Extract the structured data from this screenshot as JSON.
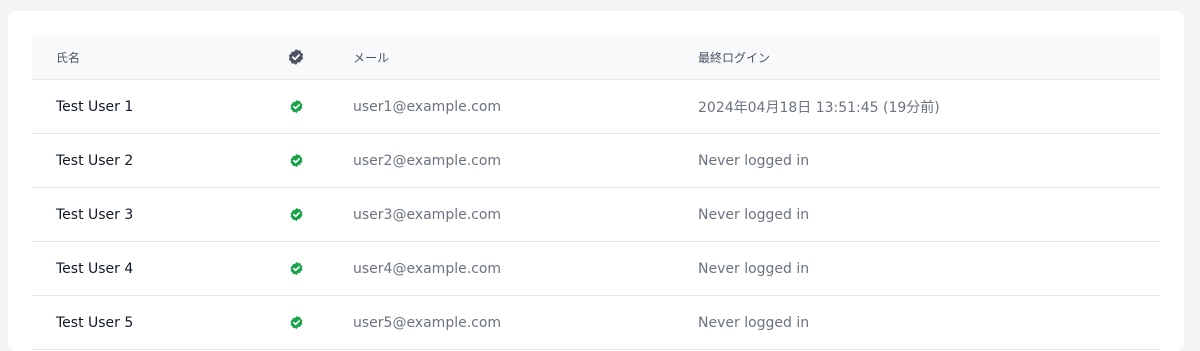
{
  "table": {
    "columns": {
      "name": "氏名",
      "verified_icon": "verified-badge-icon",
      "email": "メール",
      "last_login": "最終ログイン"
    },
    "rows": [
      {
        "name": "Test User 1",
        "verified": true,
        "email": "user1@example.com",
        "last_login": "2024年04月18日 13:51:45 (19分前)"
      },
      {
        "name": "Test User 2",
        "verified": true,
        "email": "user2@example.com",
        "last_login": "Never logged in"
      },
      {
        "name": "Test User 3",
        "verified": true,
        "email": "user3@example.com",
        "last_login": "Never logged in"
      },
      {
        "name": "Test User 4",
        "verified": true,
        "email": "user4@example.com",
        "last_login": "Never logged in"
      },
      {
        "name": "Test User 5",
        "verified": true,
        "email": "user5@example.com",
        "last_login": "Never logged in"
      }
    ]
  },
  "colors": {
    "verified_green": "#16a34a",
    "header_icon": "#4b5563"
  }
}
